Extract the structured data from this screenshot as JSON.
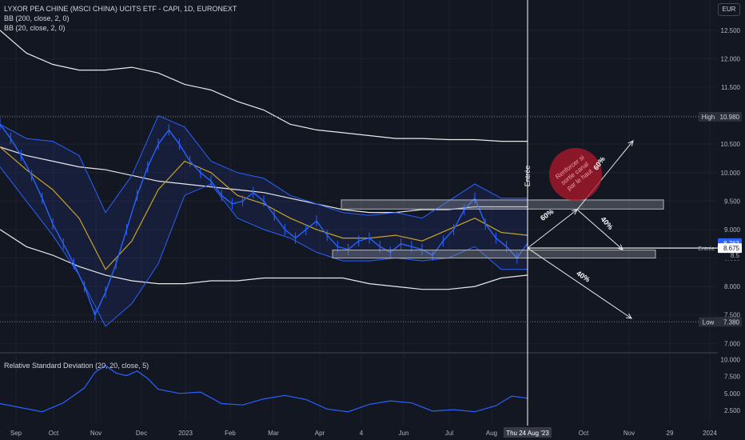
{
  "header": {
    "title": "LYXOR PEA CHINE (MSCI CHINA) UCITS ETF - CAPI, 1D, EURONEXT",
    "bb200": "BB (200, close, 2, 0)",
    "bb20": "BB (20, close, 2, 0)",
    "rsd": "Relative Standard Deviation (20, 20, close, 5)",
    "currency": "EUR"
  },
  "colors": {
    "background": "#131722",
    "price": "#2962ff",
    "bb20_band": "#2e4bd6",
    "bb20_basis": "#c9a227",
    "bb200": "#e8e8e8",
    "grid": "#1e222d",
    "annotation_circle": "#b2182b"
  },
  "chart_data": {
    "type": "line",
    "price_axis": {
      "ticks": [
        "12.500",
        "12.000",
        "11.500",
        "11.000",
        "10.500",
        "10.000",
        "9.500",
        "9.000",
        "8.500",
        "8.000",
        "7.500",
        "7.000"
      ],
      "range": [
        6.85,
        12.75
      ]
    },
    "rsd_axis": {
      "ticks": [
        "10.000",
        "7.500",
        "5.000",
        "2.500"
      ],
      "range": [
        0.5,
        10.5
      ]
    },
    "time_axis": {
      "labels": [
        "Sep",
        "Oct",
        "Nov",
        "Dec",
        "2023",
        "Feb",
        "Mar",
        "Apr",
        "4",
        "Jun",
        "Jul",
        "Aug",
        "Oct",
        "Nov",
        "29",
        "2024"
      ],
      "cursor_label": "Thu 24 Aug '23"
    },
    "price_labels": {
      "high_name": "High",
      "high_value": "10.980",
      "last_value": "8.763",
      "entry_name": "Entrée",
      "entry_value": "8.675",
      "low_name": "Low",
      "low_value": "7.380",
      "partial_value": "8.5"
    },
    "series": [
      {
        "name": "price",
        "x": [
          0,
          2,
          4,
          6,
          8,
          10,
          12,
          14,
          16,
          18,
          20,
          22,
          24,
          26,
          28,
          30,
          32,
          34,
          36,
          38,
          40,
          42,
          44,
          46,
          48,
          50,
          52,
          54,
          56,
          58,
          60,
          62,
          64,
          66,
          68,
          70,
          72,
          74,
          76,
          78,
          80,
          82,
          84,
          86,
          88,
          90,
          92,
          94,
          96,
          98,
          100
        ],
        "values": [
          10.85,
          10.6,
          10.3,
          9.95,
          9.55,
          9.1,
          8.75,
          8.4,
          8.0,
          7.5,
          7.9,
          8.4,
          9.0,
          9.6,
          10.1,
          10.5,
          10.75,
          10.5,
          10.2,
          10.0,
          9.85,
          9.6,
          9.45,
          9.5,
          9.65,
          9.5,
          9.25,
          9.0,
          8.85,
          9.0,
          9.15,
          8.9,
          8.7,
          8.65,
          8.8,
          8.85,
          8.7,
          8.6,
          8.75,
          8.7,
          8.65,
          8.55,
          8.8,
          9.0,
          9.35,
          9.55,
          9.1,
          8.85,
          8.7,
          8.5,
          8.76
        ]
      },
      {
        "name": "bb20_upper",
        "x": [
          0,
          5,
          10,
          15,
          20,
          25,
          30,
          35,
          40,
          45,
          50,
          55,
          60,
          65,
          70,
          75,
          80,
          85,
          90,
          95,
          100
        ],
        "values": [
          10.85,
          10.6,
          10.55,
          10.3,
          9.3,
          9.95,
          11.0,
          10.8,
          10.2,
          10.0,
          9.9,
          9.6,
          9.45,
          9.3,
          9.25,
          9.3,
          9.2,
          9.5,
          9.8,
          9.55,
          9.55
        ]
      },
      {
        "name": "bb20_lower",
        "x": [
          0,
          5,
          10,
          15,
          20,
          25,
          30,
          35,
          40,
          45,
          50,
          55,
          60,
          65,
          70,
          75,
          80,
          85,
          90,
          95,
          100
        ],
        "values": [
          10.1,
          9.5,
          8.9,
          8.2,
          7.3,
          7.7,
          8.4,
          9.6,
          9.8,
          9.2,
          9.0,
          8.85,
          8.6,
          8.45,
          8.45,
          8.5,
          8.45,
          8.5,
          8.7,
          8.3,
          8.3
        ]
      },
      {
        "name": "bb20_basis",
        "x": [
          0,
          5,
          10,
          15,
          20,
          25,
          30,
          35,
          40,
          45,
          50,
          55,
          60,
          65,
          70,
          75,
          80,
          85,
          90,
          95,
          100
        ],
        "values": [
          10.45,
          10.05,
          9.7,
          9.2,
          8.3,
          8.8,
          9.7,
          10.2,
          10.0,
          9.6,
          9.45,
          9.2,
          9.0,
          8.85,
          8.85,
          8.9,
          8.8,
          9.0,
          9.2,
          8.95,
          8.9
        ]
      },
      {
        "name": "bb200_upper",
        "x": [
          0,
          5,
          10,
          15,
          20,
          25,
          30,
          35,
          40,
          45,
          50,
          55,
          60,
          65,
          70,
          75,
          80,
          85,
          90,
          95,
          100
        ],
        "values": [
          12.5,
          12.1,
          11.9,
          11.8,
          11.8,
          11.85,
          11.75,
          11.55,
          11.45,
          11.25,
          11.1,
          10.85,
          10.75,
          10.7,
          10.65,
          10.6,
          10.6,
          10.58,
          10.58,
          10.55,
          10.55
        ]
      },
      {
        "name": "bb200_basis",
        "x": [
          0,
          5,
          10,
          15,
          20,
          25,
          30,
          35,
          40,
          45,
          50,
          55,
          60,
          65,
          70,
          75,
          80,
          85,
          90,
          95,
          100
        ],
        "values": [
          10.45,
          10.3,
          10.2,
          10.1,
          10.05,
          9.95,
          9.85,
          9.8,
          9.75,
          9.7,
          9.65,
          9.55,
          9.45,
          9.35,
          9.3,
          9.3,
          9.35,
          9.35,
          9.4,
          9.4,
          9.4
        ]
      },
      {
        "name": "bb200_lower",
        "x": [
          0,
          5,
          10,
          15,
          20,
          25,
          30,
          35,
          40,
          45,
          50,
          55,
          60,
          65,
          70,
          75,
          80,
          85,
          90,
          95,
          100
        ],
        "values": [
          9.0,
          8.7,
          8.55,
          8.35,
          8.2,
          8.1,
          8.05,
          8.05,
          8.1,
          8.1,
          8.15,
          8.15,
          8.15,
          8.15,
          8.05,
          8.0,
          7.95,
          7.95,
          8.0,
          8.15,
          8.2
        ]
      },
      {
        "name": "rsd",
        "x": [
          0,
          4,
          8,
          12,
          16,
          18,
          20,
          22,
          24,
          26,
          28,
          30,
          34,
          38,
          42,
          46,
          50,
          54,
          58,
          62,
          66,
          70,
          74,
          78,
          82,
          86,
          90,
          94,
          97,
          100
        ],
        "values": [
          3.5,
          2.9,
          2.3,
          3.6,
          5.8,
          8.1,
          9.1,
          8.0,
          7.6,
          8.3,
          7.2,
          5.6,
          5.0,
          5.2,
          3.5,
          3.3,
          4.2,
          4.7,
          4.1,
          2.7,
          2.3,
          3.4,
          3.9,
          3.6,
          2.4,
          2.6,
          2.3,
          3.2,
          4.6,
          4.3
        ]
      }
    ],
    "annotations": {
      "entry_label": "Entrée",
      "circle_note": "Renforcer si sortie canal par le haut",
      "up_left": "60%",
      "up_right": "60%",
      "down_right": "40%",
      "down_long": "40%"
    }
  }
}
